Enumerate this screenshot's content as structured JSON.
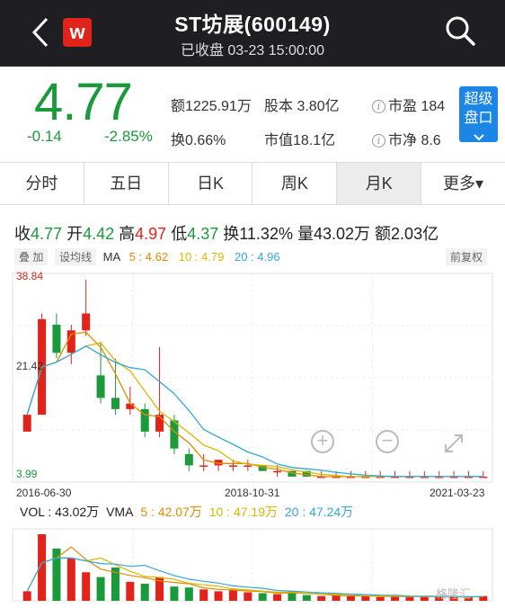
{
  "header": {
    "title": "ST坊展(600149)",
    "status": "已收盘 03-23 15:00:00",
    "logo_letter": "w"
  },
  "quote": {
    "price": "4.77",
    "change": "-0.14",
    "change_pct": "-2.85%",
    "amount": "额1225.91万",
    "share_capital": "股本 3.80亿",
    "pe": "市盈 184",
    "turnover": "换0.66%",
    "market_cap": "市值18.1亿",
    "pb": "市净 8.6",
    "super_line1": "超级",
    "super_line2": "盘口",
    "price_color": "#1a9a3a"
  },
  "tabs": [
    "分时",
    "五日",
    "日K",
    "周K",
    "月K",
    "更多▾"
  ],
  "active_tab": "月K",
  "kline_info": {
    "close_k": "收",
    "close_v": "4.77",
    "open_k": "开",
    "open_v": "4.42",
    "high_k": "高",
    "high_v": "4.97",
    "low_k": "低",
    "low_v": "4.37",
    "turn_k": "换",
    "turn_v": "11.32%",
    "vol_k": "量",
    "vol_v": "43.02万",
    "amt_k": "额",
    "amt_v": "2.03亿"
  },
  "ma_row": {
    "btn1": "叠 加",
    "btn2": "设均线",
    "ma": "MA",
    "ma5": "5 : 4.62",
    "ma10": "10 : 4.79",
    "ma20": "20 : 4.96",
    "adjust": "前复权"
  },
  "chart_labels": {
    "max": "38.84",
    "mid": "21.42",
    "min": "3.99",
    "date_start": "2016-06-30",
    "date_mid": "2018-10-31",
    "date_end": "2021-03-23"
  },
  "volume_row": {
    "vol": "VOL : 43.02万",
    "vma": "VMA",
    "vma5": "5 : 42.07万",
    "vma10": "10 : 47.19万",
    "vma20": "20 : 47.24万"
  },
  "watermark": "格隆汇",
  "colors": {
    "up": "#e2231a",
    "down": "#1a9a3a",
    "ma5": "#e08a00",
    "ma10": "#d8b800",
    "ma20": "#32a8d8"
  },
  "chart_data": {
    "type": "candlestick",
    "y_range": [
      3.99,
      38.84
    ],
    "candles": [
      [
        12,
        15,
        11,
        11,
        16
      ],
      [
        15,
        32,
        15,
        33,
        14
      ],
      [
        31,
        26,
        25,
        33,
        14
      ],
      [
        26,
        30,
        24,
        31,
        24
      ],
      [
        30,
        33,
        29,
        39,
        28
      ],
      [
        22,
        18,
        17,
        28,
        15
      ],
      [
        18,
        16,
        15,
        25,
        13
      ],
      [
        16,
        17,
        15,
        20,
        15
      ],
      [
        16,
        12,
        11,
        17,
        9
      ],
      [
        12,
        15,
        11,
        27,
        11
      ],
      [
        14,
        9,
        8,
        15,
        8
      ],
      [
        8,
        6,
        5,
        9,
        5
      ],
      [
        6,
        6,
        5,
        8,
        5
      ],
      [
        6,
        7,
        5,
        7,
        5
      ],
      [
        6,
        6,
        5,
        7,
        5
      ],
      [
        6,
        6,
        5,
        7,
        5
      ],
      [
        6,
        5,
        5,
        6,
        5
      ],
      [
        5,
        5,
        4,
        6,
        4
      ],
      [
        5,
        4,
        4,
        5,
        4
      ],
      [
        5,
        4,
        4,
        5,
        4
      ],
      [
        4,
        4,
        4,
        5,
        4
      ],
      [
        4,
        4,
        4,
        5,
        4
      ],
      [
        4,
        4,
        4,
        5,
        4
      ],
      [
        4,
        4,
        4,
        5,
        4
      ],
      [
        4,
        4,
        4,
        5,
        4
      ],
      [
        4,
        4,
        4,
        5,
        4
      ],
      [
        4,
        4,
        4,
        5,
        4
      ],
      [
        4,
        4,
        4,
        5,
        4
      ],
      [
        4,
        4,
        4,
        5,
        4
      ],
      [
        4,
        4,
        4,
        5,
        4
      ],
      [
        4,
        4,
        4,
        5,
        4
      ],
      [
        4,
        4,
        4,
        5,
        4
      ]
    ],
    "volumes": [
      10,
      70,
      55,
      45,
      30,
      25,
      35,
      20,
      18,
      25,
      15,
      14,
      12,
      10,
      12,
      9,
      8,
      7,
      10,
      6,
      5,
      6,
      5,
      5,
      4,
      5,
      4,
      5,
      4,
      4,
      4,
      5
    ],
    "candle_fields": [
      "open",
      "close",
      "low",
      "high",
      "ma_proxy"
    ]
  }
}
